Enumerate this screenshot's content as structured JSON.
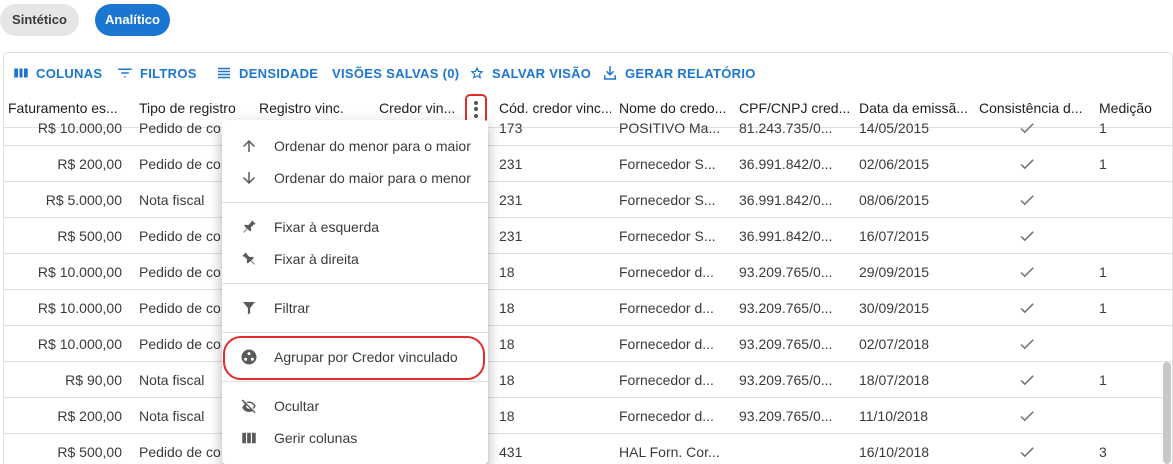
{
  "tabs": {
    "synthetic": "Sintético",
    "analytic": "Analítico"
  },
  "toolbar": {
    "columns": "COLUNAS",
    "filters": "FILTROS",
    "density": "DENSIDADE",
    "saved_views": "VISÕES SALVAS (0)",
    "save_view": "SALVAR VISÃO",
    "generate_report": "GERAR RELATÓRIO"
  },
  "columns": {
    "faturamento": "Faturamento es...",
    "tipo": "Tipo de registro",
    "registro": "Registro vinc.",
    "credor": "Credor vin...",
    "cod": "Cód. credor vinc...",
    "nome": "Nome do credo...",
    "cpf": "CPF/CNPJ cred...",
    "data": "Data da emissã...",
    "consistencia": "Consistência d...",
    "medicao": "Medição"
  },
  "rows": [
    {
      "faturamento": "R$ 10.000,00",
      "tipo": "Pedido de co",
      "cod": "173",
      "nome": "POSITIVO Ma...",
      "cpf": "81.243.735/0...",
      "data": "14/05/2015",
      "check": true,
      "medicao": "1"
    },
    {
      "faturamento": "R$ 200,00",
      "tipo": "Pedido de co",
      "cod": "231",
      "nome": "Fornecedor S...",
      "cpf": "36.991.842/0...",
      "data": "02/06/2015",
      "check": true,
      "medicao": "1"
    },
    {
      "faturamento": "R$ 5.000,00",
      "tipo": "Nota fiscal",
      "cod": "231",
      "nome": "Fornecedor S...",
      "cpf": "36.991.842/0...",
      "data": "08/06/2015",
      "check": true,
      "medicao": ""
    },
    {
      "faturamento": "R$ 500,00",
      "tipo": "Pedido de co",
      "cod": "231",
      "nome": "Fornecedor S...",
      "cpf": "36.991.842/0...",
      "data": "16/07/2015",
      "check": true,
      "medicao": ""
    },
    {
      "faturamento": "R$ 10.000,00",
      "tipo": "Pedido de co",
      "cod": "18",
      "nome": "Fornecedor d...",
      "cpf": "93.209.765/0...",
      "data": "29/09/2015",
      "check": true,
      "medicao": "1"
    },
    {
      "faturamento": "R$ 10.000,00",
      "tipo": "Pedido de co",
      "cod": "18",
      "nome": "Fornecedor d...",
      "cpf": "93.209.765/0...",
      "data": "30/09/2015",
      "check": true,
      "medicao": "1"
    },
    {
      "faturamento": "R$ 10.000,00",
      "tipo": "Pedido de co",
      "cod": "18",
      "nome": "Fornecedor d...",
      "cpf": "93.209.765/0...",
      "data": "02/07/2018",
      "check": true,
      "medicao": ""
    },
    {
      "faturamento": "R$ 90,00",
      "tipo": "Nota fiscal",
      "cod": "18",
      "nome": "Fornecedor d...",
      "cpf": "93.209.765/0...",
      "data": "18/07/2018",
      "check": true,
      "medicao": "1"
    },
    {
      "faturamento": "R$ 200,00",
      "tipo": "Nota fiscal",
      "cod": "18",
      "nome": "Fornecedor d...",
      "cpf": "93.209.765/0...",
      "data": "11/10/2018",
      "check": true,
      "medicao": ""
    },
    {
      "faturamento": "R$ 500,00",
      "tipo": "Pedido de co",
      "cod": "431",
      "nome": "HAL Forn. Cor...",
      "cpf": "",
      "data": "16/10/2018",
      "check": true,
      "medicao": "3"
    }
  ],
  "column_menu": {
    "sort_asc": "Ordenar do menor para o maior",
    "sort_desc": "Ordenar do maior para o menor",
    "pin_left": "Fixar à esquerda",
    "pin_right": "Fixar à direita",
    "filter": "Filtrar",
    "group_by": "Agrupar por Credor vinculado",
    "hide": "Ocultar",
    "manage_columns": "Gerir colunas"
  },
  "colors": {
    "primary": "#1b76d2",
    "highlight": "#e32b2b"
  }
}
